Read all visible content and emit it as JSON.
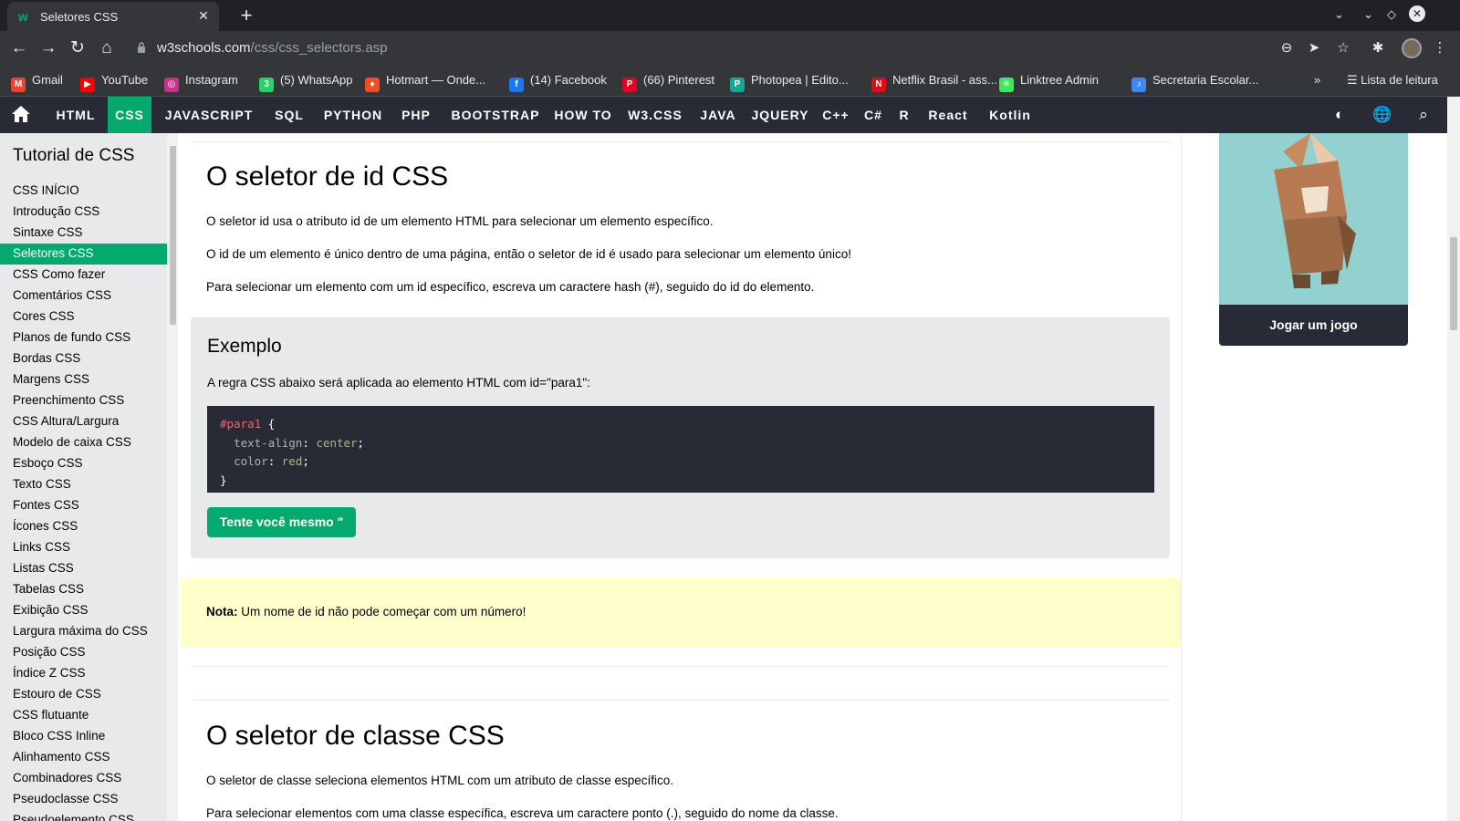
{
  "browser": {
    "tab_title": "Seletores CSS",
    "tab_favicon": "w",
    "url_host": "w3schools.com",
    "url_path": "/css/css_selectors.asp",
    "bookmarks": [
      {
        "label": "Gmail",
        "icon": "gmail-icon",
        "color": "#ea4335",
        "glyph": "M"
      },
      {
        "label": "YouTube",
        "icon": "youtube-icon",
        "color": "#ff0000",
        "glyph": "▶"
      },
      {
        "label": "Instagram",
        "icon": "instagram-icon",
        "color": "#c13584",
        "glyph": "◎"
      },
      {
        "label": "(5) WhatsApp",
        "icon": "whatsapp-icon",
        "color": "#25d366",
        "glyph": "3"
      },
      {
        "label": "Hotmart — Onde...",
        "icon": "hotmart-icon",
        "color": "#f04e23",
        "glyph": "♦"
      },
      {
        "label": "(14) Facebook",
        "icon": "facebook-icon",
        "color": "#1877f2",
        "glyph": "f"
      },
      {
        "label": "(66) Pinterest",
        "icon": "pinterest-icon",
        "color": "#e60023",
        "glyph": "P"
      },
      {
        "label": "Photopea | Edito...",
        "icon": "photopea-icon",
        "color": "#18a497",
        "glyph": "P"
      },
      {
        "label": "Netflix Brasil - ass...",
        "icon": "netflix-icon",
        "color": "#e50914",
        "glyph": "N"
      },
      {
        "label": "Linktree Admin",
        "icon": "linktree-icon",
        "color": "#43e55e",
        "glyph": "✳"
      },
      {
        "label": "Secretaria Escolar...",
        "icon": "secretaria-icon",
        "color": "#4285f4",
        "glyph": "♪"
      }
    ],
    "more_bookmarks": "»",
    "reading_list": "Lista de leitura"
  },
  "w3nav": {
    "items": [
      "HTML",
      "CSS",
      "JAVASCRIPT",
      "SQL",
      "PYTHON",
      "PHP",
      "BOOTSTRAP",
      "HOW TO",
      "W3.CSS",
      "JAVA",
      "JQUERY",
      "C++",
      "C#",
      "R",
      "React",
      "Kotlin"
    ],
    "active": "CSS"
  },
  "sidebar": {
    "title": "Tutorial de CSS",
    "items": [
      "CSS INÍCIO",
      "Introdução CSS",
      "Sintaxe CSS",
      "Seletores CSS",
      "CSS Como fazer",
      "Comentários CSS",
      "Cores CSS",
      "Planos de fundo CSS",
      "Bordas CSS",
      "Margens CSS",
      "Preenchimento CSS",
      "CSS Altura/Largura",
      "Modelo de caixa CSS",
      "Esboço CSS",
      "Texto CSS",
      "Fontes CSS",
      "Ícones CSS",
      "Links CSS",
      "Listas CSS",
      "Tabelas CSS",
      "Exibição CSS",
      "Largura máxima do CSS",
      "Posição CSS",
      "Índice Z CSS",
      "Estouro de CSS",
      "CSS flutuante",
      "Bloco CSS Inline",
      "Alinhamento CSS",
      "Combinadores CSS",
      "Pseudoclasse CSS",
      "Pseudoelemento CSS"
    ],
    "active": "Seletores CSS"
  },
  "main": {
    "section1_title": "O seletor de id CSS",
    "p1": "O seletor id usa o atributo id de um elemento HTML para selecionar um elemento específico.",
    "p2": "O id de um elemento é único dentro de uma página, então o seletor de id é usado para selecionar um elemento único!",
    "p3": "Para selecionar um elemento com um id específico, escreva um caractere hash (#), seguido do id do elemento.",
    "example_title": "Exemplo",
    "example_text": "A regra CSS abaixo será aplicada ao elemento HTML com id=\"para1\":",
    "code": {
      "selector": "#para1",
      "open": " {",
      "prop1": "text-align",
      "val1": "center",
      "prop2": "color",
      "val2": "red",
      "close": "}"
    },
    "try_button": "Tente você mesmo \"",
    "note_label": "Nota:",
    "note_text": " Um nome de id não pode começar com um número!",
    "section2_title": "O seletor de classe CSS",
    "p4": "O seletor de classe seleciona elementos HTML com um atributo de classe específico.",
    "p5": "Para selecionar elementos com uma classe específica, escreva um caractere ponto (.), seguido do nome da classe."
  },
  "ad": {
    "button": "Jogar um jogo"
  },
  "colors": {
    "accent": "#04aa6d",
    "nav_bg": "#282a35",
    "note_bg": "#ffffcc"
  }
}
